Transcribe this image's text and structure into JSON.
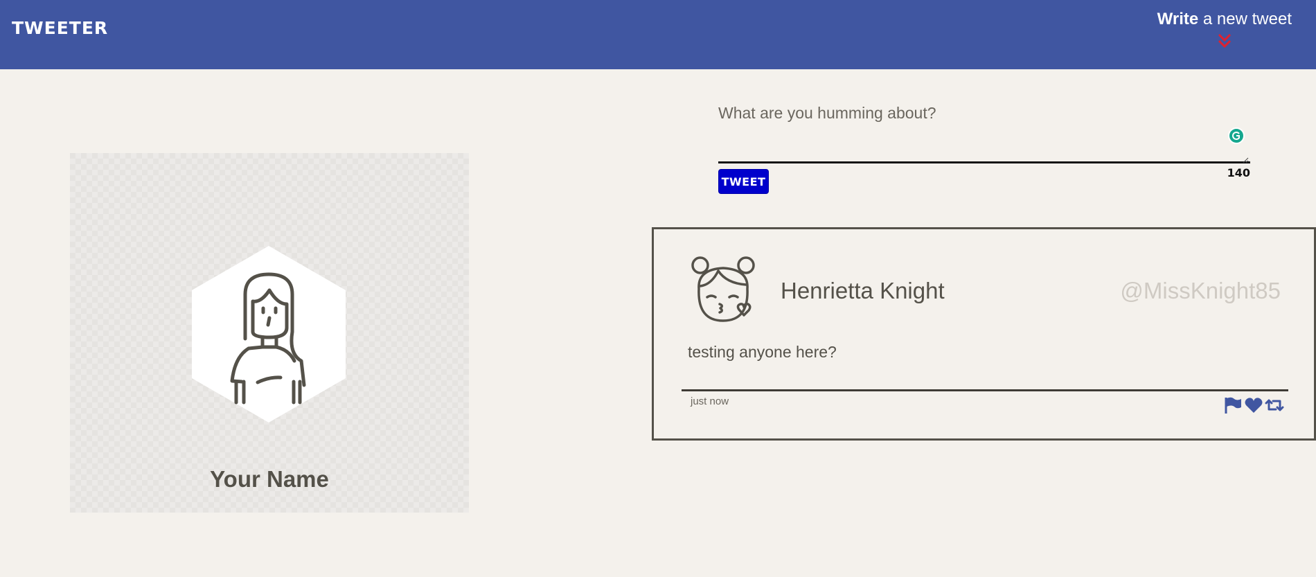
{
  "nav": {
    "brand": "TWEETER",
    "compose_strong": "Write",
    "compose_rest": " a new tweet",
    "toggle_icon": "double-chevron-down-icon"
  },
  "profile": {
    "name": "Your Name",
    "avatar_icon": "girl-avatar-icon"
  },
  "composer": {
    "placeholder": "What are you humming about?",
    "button_label": "TWEET",
    "counter": "140"
  },
  "tweet": {
    "name": "Henrietta Knight",
    "handle": "@MissKnight85",
    "text": "testing anyone here?",
    "timestamp": "just now",
    "avatar_icon": "kissing-face-avatar-icon",
    "actions": [
      "flag-icon",
      "heart-icon",
      "retweet-icon"
    ]
  },
  "colors": {
    "nav_bg": "#4056a1",
    "page_bg": "#f4f1ec",
    "text": "#545149",
    "handle": "#cfcac3",
    "button": "#0000cc",
    "chevron": "#e0212f"
  }
}
